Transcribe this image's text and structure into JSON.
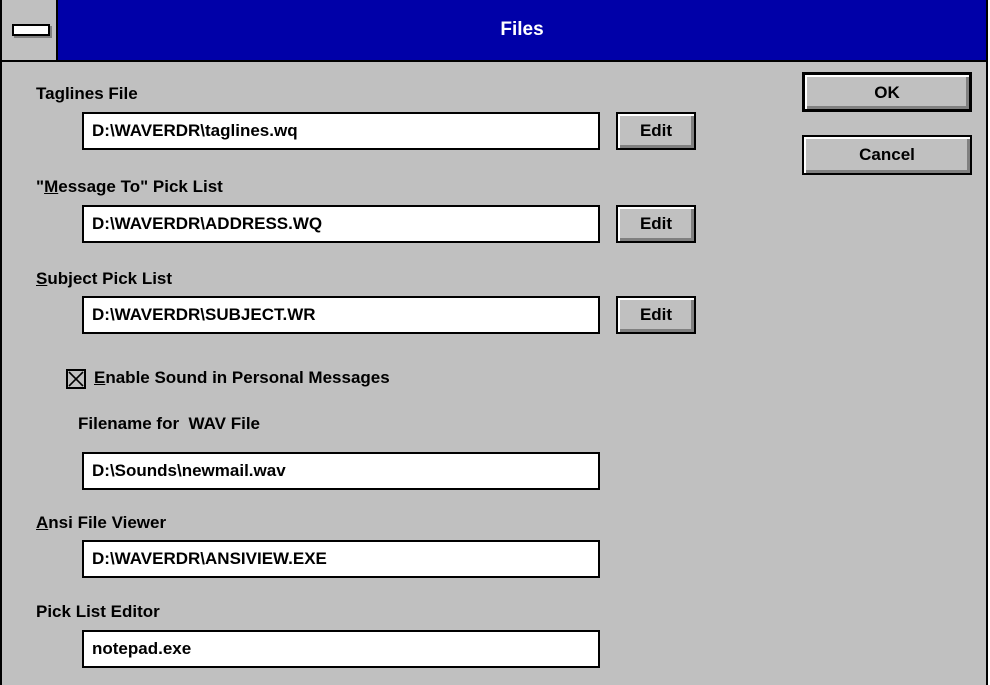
{
  "window": {
    "title": "Files"
  },
  "buttons": {
    "ok": "OK",
    "cancel": "Cancel",
    "edit": "Edit"
  },
  "taglines": {
    "label": "Taglines File",
    "value": "D:\\WAVERDR\\taglines.wq"
  },
  "message_to": {
    "label_pre": "\"",
    "label_u": "M",
    "label_post": "essage To\" Pick List",
    "value": "D:\\WAVERDR\\ADDRESS.WQ"
  },
  "subject": {
    "label_u": "S",
    "label_post": "ubject Pick List",
    "value": "D:\\WAVERDR\\SUBJECT.WR"
  },
  "sound": {
    "checked": true,
    "label_u": "E",
    "label_post": "nable Sound in Personal Messages"
  },
  "wav": {
    "label": "Filename for  WAV File",
    "value": "D:\\Sounds\\newmail.wav"
  },
  "ansi": {
    "label_u": "A",
    "label_post": "nsi File Viewer",
    "value": "D:\\WAVERDR\\ANSIVIEW.EXE"
  },
  "pick_editor": {
    "label": "Pick List Editor",
    "value": "notepad.exe"
  },
  "colors": {
    "titlebar": "#0000a8",
    "face": "#c0c0c0",
    "field": "#ffffff"
  },
  "icons": {
    "system_menu": "system-menu-icon",
    "checkbox": "checkbox-checked-icon"
  }
}
